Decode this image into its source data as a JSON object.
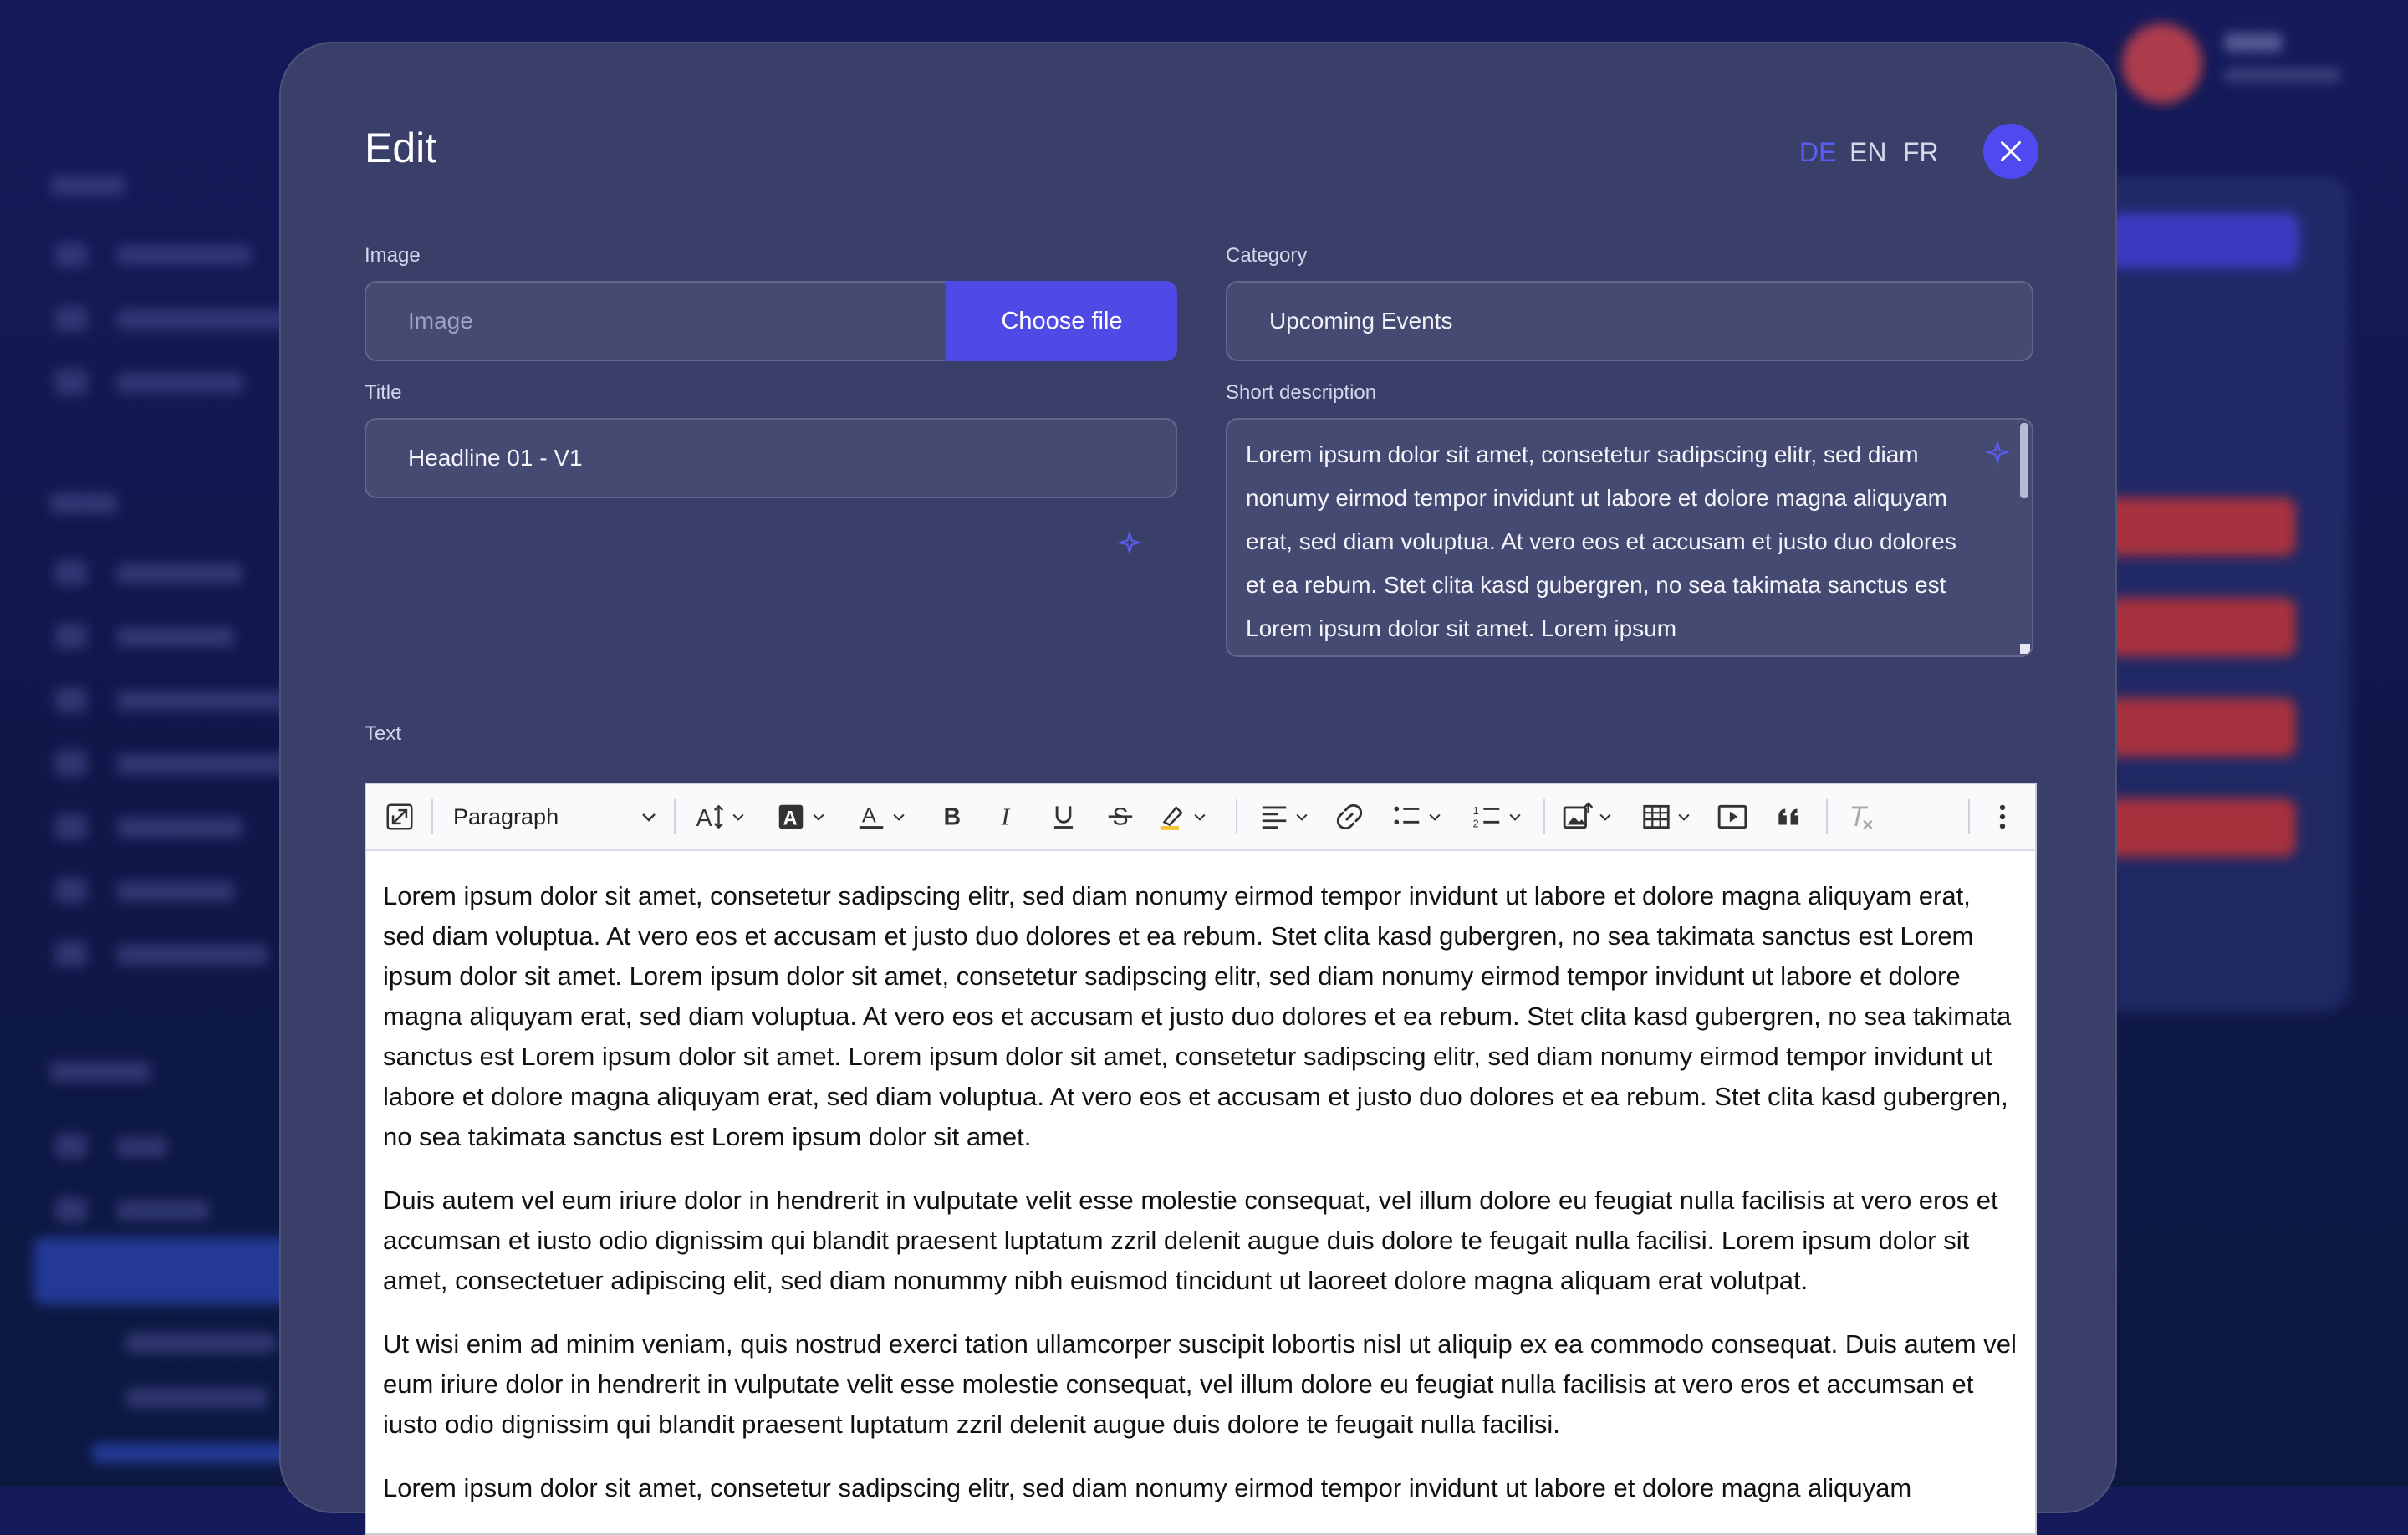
{
  "modal": {
    "title": "Edit",
    "languages": [
      {
        "code": "DE",
        "active": true
      },
      {
        "code": "EN",
        "active": false
      },
      {
        "code": "FR",
        "active": false
      }
    ],
    "close_icon": "close-icon"
  },
  "fields": {
    "image": {
      "label": "Image",
      "placeholder": "Image",
      "button": "Choose file"
    },
    "category": {
      "label": "Category",
      "value": "Upcoming Events"
    },
    "title": {
      "label": "Title",
      "value": "Headline 01 - V1"
    },
    "short_description": {
      "label": "Short description",
      "value": "Lorem ipsum dolor sit amet, consetetur sadipscing elitr, sed diam nonumy eirmod tempor invidunt ut labore et dolore magna aliquyam erat, sed diam voluptua. At vero eos et accusam et justo duo dolores et ea rebum. Stet clita kasd gubergren, no sea takimata sanctus est Lorem ipsum dolor sit amet. Lorem ipsum"
    },
    "text": {
      "label": "Text"
    }
  },
  "editor": {
    "paragraph_style": "Paragraph",
    "paragraphs": [
      "Lorem ipsum dolor sit amet, consetetur sadipscing elitr, sed diam nonumy eirmod tempor invidunt ut labore et dolore magna aliquyam erat, sed diam voluptua. At vero eos et accusam et justo duo dolores et ea rebum. Stet clita kasd gubergren, no sea takimata sanctus est Lorem ipsum dolor sit amet. Lorem ipsum dolor sit amet, consetetur sadipscing elitr, sed diam nonumy eirmod tempor invidunt ut labore et dolore magna aliquyam erat, sed diam voluptua. At vero eos et accusam et justo duo dolores et ea rebum. Stet clita kasd gubergren, no sea takimata sanctus est Lorem ipsum dolor sit amet. Lorem ipsum dolor sit amet, consetetur sadipscing elitr, sed diam nonumy eirmod tempor invidunt ut labore et dolore magna aliquyam erat, sed diam voluptua. At vero eos et accusam et justo duo dolores et ea rebum. Stet clita kasd gubergren, no sea takimata sanctus est Lorem ipsum dolor sit amet.",
      "Duis autem vel eum iriure dolor in hendrerit in vulputate velit esse molestie consequat, vel illum dolore eu feugiat nulla facilisis at vero eros et accumsan et iusto odio dignissim qui blandit praesent luptatum zzril delenit augue duis dolore te feugait nulla facilisi. Lorem ipsum dolor sit amet, consectetuer adipiscing elit, sed diam nonummy nibh euismod tincidunt ut laoreet dolore magna aliquam erat volutpat.",
      "Ut wisi enim ad minim veniam, quis nostrud exerci tation ullamcorper suscipit lobortis nisl ut aliquip ex ea commodo consequat. Duis autem vel eum iriure dolor in hendrerit in vulputate velit esse molestie consequat, vel illum dolore eu feugiat nulla facilisis at vero eros et accumsan et iusto odio dignissim qui blandit praesent luptatum zzril delenit augue duis dolore te feugait nulla facilisi.",
      "Lorem ipsum dolor sit amet, consetetur sadipscing elitr, sed diam nonumy eirmod tempor invidunt ut labore et dolore magna aliquyam"
    ],
    "toolbar_icons": [
      "fullscreen-icon",
      "paragraph-dropdown",
      "font-size-icon",
      "font-background-color-icon",
      "font-color-icon",
      "bold-icon",
      "italic-icon",
      "underline-icon",
      "strikethrough-icon",
      "highlight-icon",
      "align-icon",
      "link-icon",
      "bulleted-list-icon",
      "numbered-list-icon",
      "insert-image-icon",
      "table-icon",
      "media-embed-icon",
      "blockquote-icon",
      "remove-format-icon",
      "more-icon"
    ]
  },
  "colors": {
    "accent": "#4f4ae6",
    "active_language": "#5b5ef5",
    "modal_bg": "#3a3f6a",
    "danger": "#d93a3a"
  }
}
